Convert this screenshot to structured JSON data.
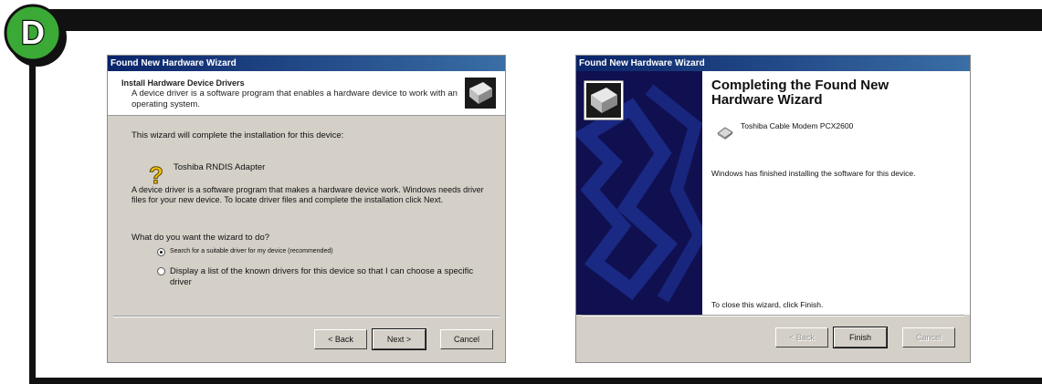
{
  "badge": {
    "letter": "D",
    "fill_color": "#3aa935"
  },
  "left_dialog": {
    "title": "Found New Hardware Wizard",
    "header_title": "Install Hardware Device Drivers",
    "header_desc": "A device driver is a software program that enables a hardware device to work with an operating system.",
    "intro": "This wizard will complete the installation for this device:",
    "device_name": "Toshiba RNDIS Adapter",
    "body": "A device driver is a software program that makes a hardware device work. Windows needs driver files for your new device. To locate driver files and complete the installation click Next.",
    "question": "What do you want the wizard to do?",
    "options": [
      {
        "label": "Search for a suitable driver for my device (recommended)",
        "selected": true
      },
      {
        "label": "Display a list of the known drivers for this device so that I can choose a specific driver",
        "selected": false
      }
    ],
    "buttons": {
      "back": "< Back",
      "next": "Next >",
      "cancel": "Cancel"
    }
  },
  "right_dialog": {
    "title": "Found New Hardware Wizard",
    "heading": "Completing the Found New Hardware Wizard",
    "device_name": "Toshiba Cable Modem PCX2600",
    "message": "Windows has finished installing the software for this device.",
    "close_hint": "To close this wizard, click Finish.",
    "buttons": {
      "back": "< Back",
      "finish": "Finish",
      "cancel": "Cancel"
    }
  },
  "colors": {
    "titlebar": "#0a246a",
    "dialog_bg": "#d4d0c8",
    "banner": "#101050",
    "frame": "#111111"
  }
}
